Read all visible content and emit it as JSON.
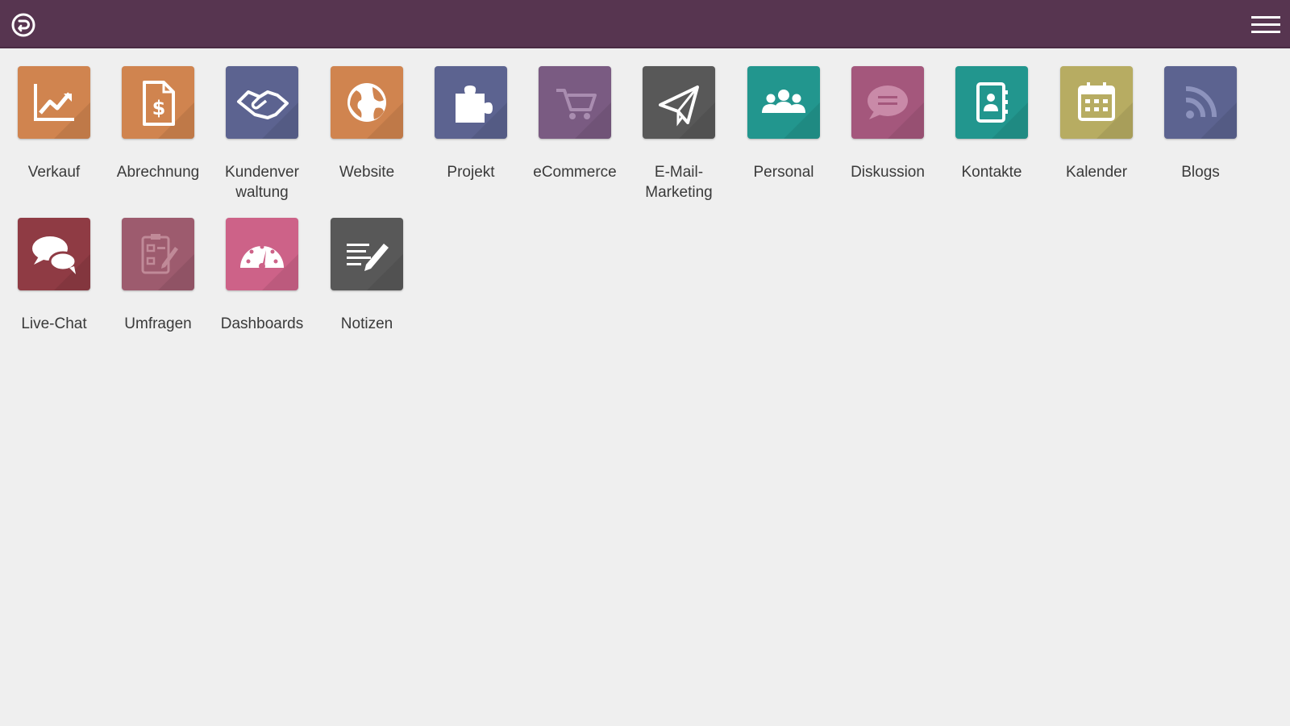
{
  "header": {
    "home_icon": "odoo-home-icon",
    "menu_icon": "hamburger-menu-icon",
    "bar_color": "#573550"
  },
  "apps": [
    {
      "id": "verkauf",
      "label": "Verkauf",
      "icon": "trend-chart-icon",
      "color": "#d0844f"
    },
    {
      "id": "abrechnung",
      "label": "Abrechnung",
      "icon": "invoice-dollar-icon",
      "color": "#d0844f"
    },
    {
      "id": "kundenverwaltung",
      "label": "Kundenver waltung",
      "icon": "handshake-icon",
      "color": "#5c6390"
    },
    {
      "id": "website",
      "label": "Website",
      "icon": "globe-icon",
      "color": "#d0844f"
    },
    {
      "id": "projekt",
      "label": "Projekt",
      "icon": "puzzle-icon",
      "color": "#5c6390"
    },
    {
      "id": "ecommerce",
      "label": "eCommerce",
      "icon": "shopping-cart-icon",
      "color": "#7a5b82"
    },
    {
      "id": "email-marketing",
      "label": "E-Mail-Marketing",
      "icon": "paper-plane-icon",
      "color": "#585858"
    },
    {
      "id": "personal",
      "label": "Personal",
      "icon": "people-group-icon",
      "color": "#22968e"
    },
    {
      "id": "diskussion",
      "label": "Diskussion",
      "icon": "speech-bubble-icon",
      "color": "#a4577c"
    },
    {
      "id": "kontakte",
      "label": "Kontakte",
      "icon": "address-book-icon",
      "color": "#22968e"
    },
    {
      "id": "kalender",
      "label": "Kalender",
      "icon": "calendar-icon",
      "color": "#b7ac62"
    },
    {
      "id": "blogs",
      "label": "Blogs",
      "icon": "rss-feed-icon",
      "color": "#5c6390"
    },
    {
      "id": "live-chat",
      "label": "Live-Chat",
      "icon": "chat-bubbles-icon",
      "color": "#8f3b44"
    },
    {
      "id": "umfragen",
      "label": "Umfragen",
      "icon": "survey-clipboard-icon",
      "color": "#9d5b6e"
    },
    {
      "id": "dashboards",
      "label": "Dashboards",
      "icon": "speedometer-icon",
      "color": "#cd6288"
    },
    {
      "id": "notizen",
      "label": "Notizen",
      "icon": "notes-pen-icon",
      "color": "#585858"
    }
  ]
}
